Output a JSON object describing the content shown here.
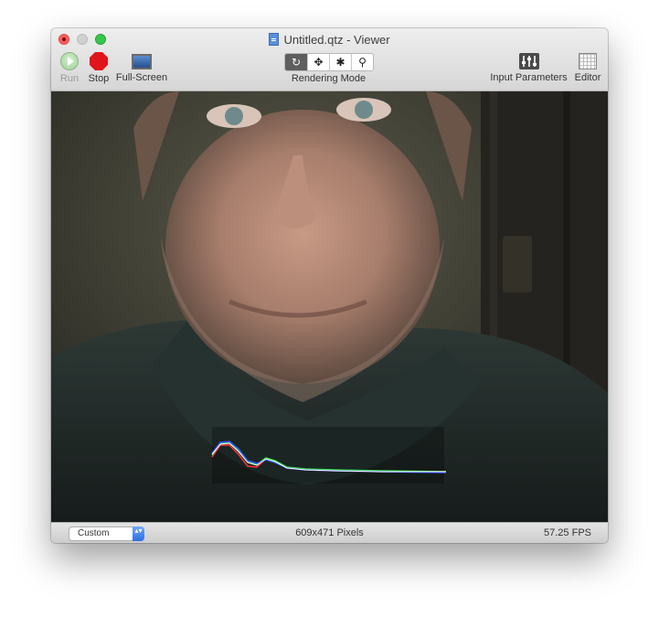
{
  "window": {
    "title": "Untitled.qtz - Viewer",
    "traffic_colors": {
      "close": "#fc605c",
      "minimize": "#d0d0d0",
      "zoom": "#34c84a"
    }
  },
  "toolbar": {
    "run_label": "Run",
    "stop_label": "Stop",
    "fullscreen_label": "Full-Screen",
    "rendering_mode_label": "Rendering Mode",
    "rendering_modes": [
      {
        "icon": "refresh-icon",
        "glyph": "↻",
        "selected": true
      },
      {
        "icon": "move-icon",
        "glyph": "✥",
        "selected": false
      },
      {
        "icon": "bug-icon",
        "glyph": "✱",
        "selected": false
      },
      {
        "icon": "magnifier-icon",
        "glyph": "⚲",
        "selected": false
      }
    ],
    "input_parameters_label": "Input Parameters",
    "editor_label": "Editor"
  },
  "status": {
    "size_mode": "Custom",
    "size_mode_arrow": "▴▾",
    "dimensions": "609x471 Pixels",
    "fps": "57.25 FPS"
  },
  "colors": {
    "stop_red": "#e0151b",
    "run_green": "#9dcf95",
    "accent_blue": "#2e6ee3"
  }
}
